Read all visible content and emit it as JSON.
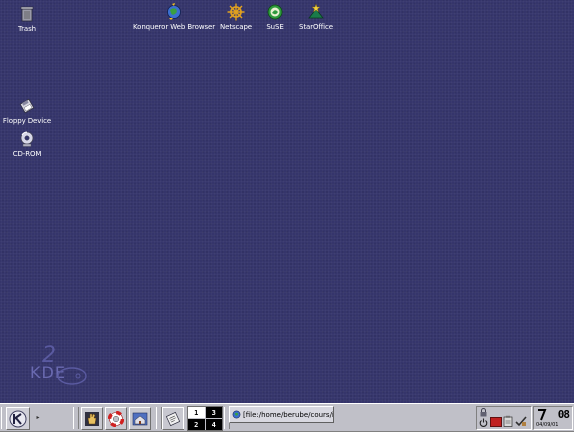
{
  "desktop": {
    "icons": {
      "trash": "Trash",
      "konqueror": "Konqueror Web Browser",
      "netscape": "Netscape",
      "suse": "SuSE",
      "staroffice": "StarOffice",
      "floppy": "Floppy Device",
      "cdrom": "CD-ROM"
    },
    "background_color": "#35356b"
  },
  "panel": {
    "kmenu_label": "K",
    "pager": [
      "1",
      "3",
      "2",
      "4"
    ],
    "active_desktop": "1",
    "taskbar_item": "[file:/home/berube/cours/i...",
    "clock_time": "08",
    "clock_date": "04/09/01"
  }
}
